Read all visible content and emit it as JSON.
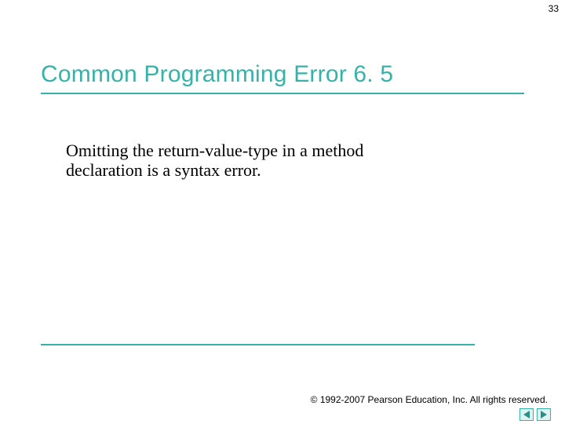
{
  "page_number": "33",
  "title": "Common Programming Error 6. 5",
  "body": "Omitting the return-value-type in a method declaration is a syntax error.",
  "copyright": "© 1992-2007 Pearson Education, Inc.  All rights reserved.",
  "colors": {
    "accent": "#36b3a8",
    "nav_fill": "#dff3f1"
  },
  "nav": {
    "prev_icon": "triangle-left-icon",
    "next_icon": "triangle-right-icon"
  }
}
